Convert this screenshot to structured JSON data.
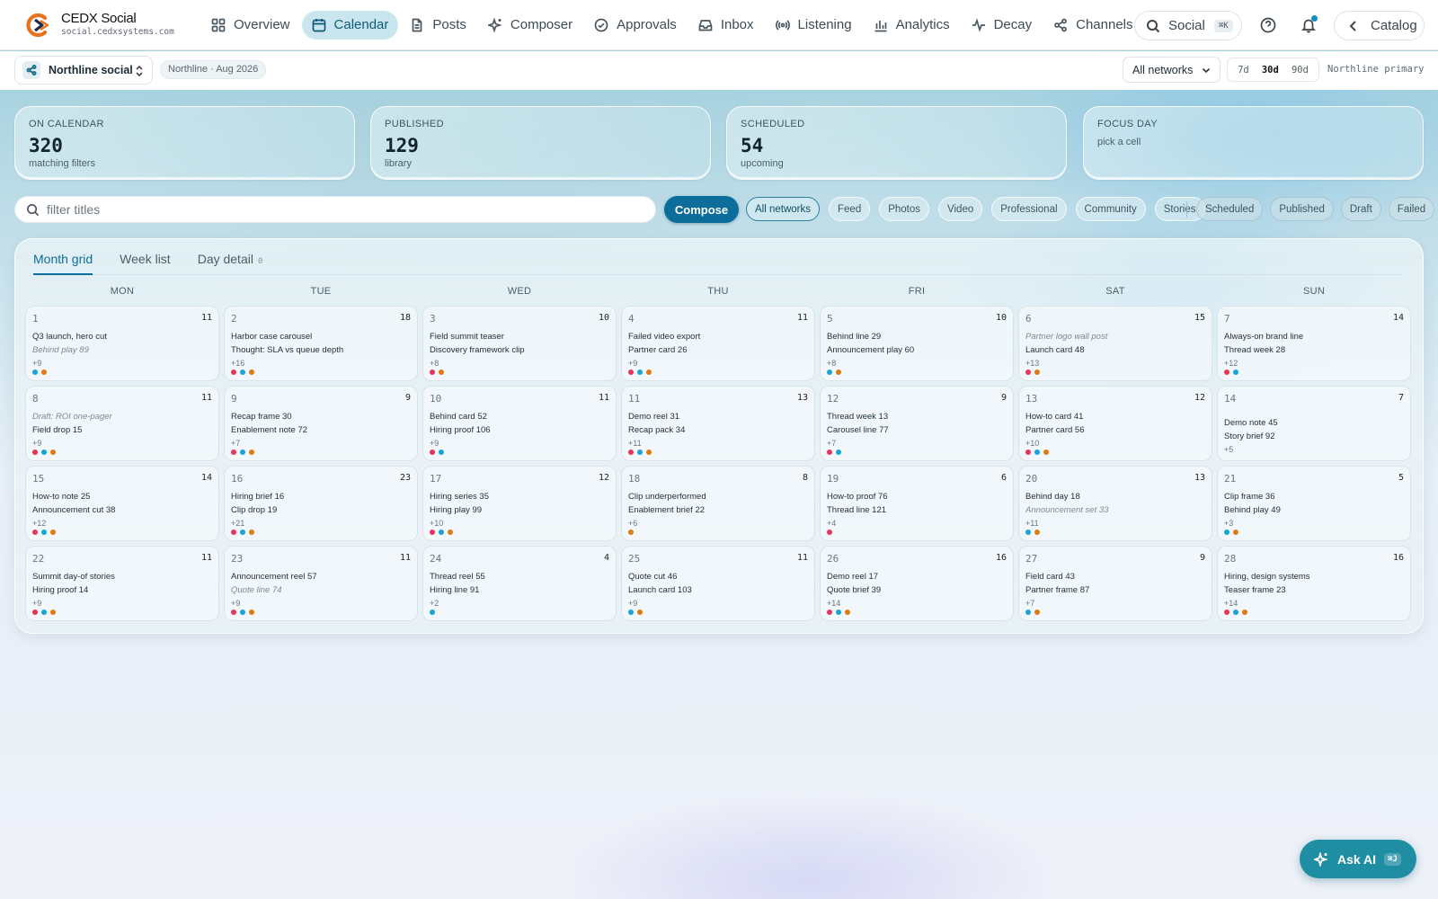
{
  "brand": {
    "title": "CEDX Social",
    "domain": "social.cedxsystems.com"
  },
  "nav": [
    {
      "label": "Overview",
      "icon": "grid-icon",
      "active": false
    },
    {
      "label": "Calendar",
      "icon": "calendar-icon",
      "active": true
    },
    {
      "label": "Posts",
      "icon": "document-icon",
      "active": false
    },
    {
      "label": "Composer",
      "icon": "sparkle-icon",
      "active": false
    },
    {
      "label": "Approvals",
      "icon": "check-circle-icon",
      "active": false
    },
    {
      "label": "Inbox",
      "icon": "inbox-icon",
      "active": false
    },
    {
      "label": "Listening",
      "icon": "broadcast-icon",
      "active": false
    },
    {
      "label": "Analytics",
      "icon": "bar-chart-icon",
      "active": false
    },
    {
      "label": "Decay",
      "icon": "pulse-icon",
      "active": false
    },
    {
      "label": "Channels",
      "icon": "share-icon",
      "active": false
    }
  ],
  "search": {
    "label": "Social",
    "shortcut": "⌘K"
  },
  "catalog": {
    "label": "Catalog"
  },
  "workspace": {
    "name": "Northline social",
    "period": "Northline · Aug 2026"
  },
  "network_filter": {
    "selected": "All networks"
  },
  "ranges": [
    {
      "label": "7d",
      "active": false
    },
    {
      "label": "30d",
      "active": true
    },
    {
      "label": "90d",
      "active": false
    }
  ],
  "brand_kit": "Northline primary",
  "stats": [
    {
      "label": "On calendar",
      "value": "320",
      "sub": "matching filters"
    },
    {
      "label": "Published",
      "value": "129",
      "sub": "library"
    },
    {
      "label": "Scheduled",
      "value": "54",
      "sub": "upcoming"
    },
    {
      "label": "Focus day",
      "value": "",
      "sub": "pick a cell"
    }
  ],
  "filter": {
    "placeholder": "filter titles",
    "value": ""
  },
  "compose_label": "Compose",
  "network_chips": [
    {
      "label": "All networks",
      "active": true
    },
    {
      "label": "Feed",
      "active": false
    },
    {
      "label": "Photos",
      "active": false
    },
    {
      "label": "Video",
      "active": false
    },
    {
      "label": "Professional",
      "active": false
    },
    {
      "label": "Community",
      "active": false
    },
    {
      "label": "Stories",
      "active": false
    }
  ],
  "status_chips": [
    {
      "label": "Scheduled"
    },
    {
      "label": "Published"
    },
    {
      "label": "Draft"
    },
    {
      "label": "Failed"
    }
  ],
  "view_tabs": [
    {
      "label": "Month grid",
      "active": true,
      "count": ""
    },
    {
      "label": "Week list",
      "active": false,
      "count": ""
    },
    {
      "label": "Day detail",
      "active": false,
      "count": "0"
    }
  ],
  "weekdays": [
    "MON",
    "TUE",
    "WED",
    "THU",
    "FRI",
    "SAT",
    "SUN"
  ],
  "dot_colors": {
    "pink": "#e8335a",
    "blue": "#1aa3d9",
    "orange": "#e07b12"
  },
  "days": [
    {
      "day": "1",
      "count": "11",
      "posts": [
        {
          "t": "Q3 launch, hero cut"
        },
        {
          "t": "Behind play 89",
          "draft": true
        }
      ],
      "more": "+9",
      "dots": [
        "blue",
        "orange"
      ]
    },
    {
      "day": "2",
      "count": "18",
      "posts": [
        {
          "t": "Harbor case carousel"
        },
        {
          "t": "Thought: SLA vs queue depth"
        }
      ],
      "more": "+16",
      "dots": [
        "pink",
        "blue",
        "orange"
      ]
    },
    {
      "day": "3",
      "count": "10",
      "posts": [
        {
          "t": "Field summit teaser"
        },
        {
          "t": "Discovery framework clip"
        }
      ],
      "more": "+8",
      "dots": [
        "pink",
        "orange"
      ]
    },
    {
      "day": "4",
      "count": "11",
      "posts": [
        {
          "t": "Failed video export"
        },
        {
          "t": "Partner card 26"
        }
      ],
      "more": "+9",
      "dots": [
        "pink",
        "blue",
        "orange"
      ]
    },
    {
      "day": "5",
      "count": "10",
      "posts": [
        {
          "t": "Behind line 29"
        },
        {
          "t": "Announcement play 60"
        }
      ],
      "more": "+8",
      "dots": [
        "blue",
        "orange"
      ]
    },
    {
      "day": "6",
      "count": "15",
      "posts": [
        {
          "t": "Partner logo wall post",
          "draft": true
        },
        {
          "t": "Launch card 48"
        }
      ],
      "more": "+13",
      "dots": [
        "pink",
        "orange"
      ]
    },
    {
      "day": "7",
      "count": "14",
      "posts": [
        {
          "t": "Always-on brand line"
        },
        {
          "t": "Thread week 28"
        }
      ],
      "more": "+12",
      "dots": [
        "pink",
        "blue"
      ]
    },
    {
      "day": "8",
      "count": "11",
      "posts": [
        {
          "t": "Draft: ROI one-pager",
          "draft": true
        },
        {
          "t": "Field drop 15"
        }
      ],
      "more": "+9",
      "dots": [
        "pink",
        "blue",
        "orange"
      ]
    },
    {
      "day": "9",
      "count": "9",
      "posts": [
        {
          "t": "Recap frame 30"
        },
        {
          "t": "Enablement note 72"
        }
      ],
      "more": "+7",
      "dots": [
        "pink",
        "blue",
        "orange"
      ]
    },
    {
      "day": "10",
      "count": "11",
      "posts": [
        {
          "t": "Behind card 52"
        },
        {
          "t": "Hiring proof 106"
        }
      ],
      "more": "+9",
      "dots": [
        "pink",
        "blue"
      ]
    },
    {
      "day": "11",
      "count": "13",
      "posts": [
        {
          "t": "Demo reel 31"
        },
        {
          "t": "Recap pack 34"
        }
      ],
      "more": "+11",
      "dots": [
        "pink",
        "blue",
        "orange"
      ]
    },
    {
      "day": "12",
      "count": "9",
      "posts": [
        {
          "t": "Thread week 13"
        },
        {
          "t": "Carousel line 77"
        }
      ],
      "more": "+7",
      "dots": [
        "pink",
        "blue"
      ]
    },
    {
      "day": "13",
      "count": "12",
      "posts": [
        {
          "t": "How-to card 41"
        },
        {
          "t": "Partner card 56"
        }
      ],
      "more": "+10",
      "dots": [
        "pink",
        "blue",
        "orange"
      ]
    },
    {
      "day": "14",
      "count": "7",
      "posts": [
        {
          "t": "Demo note 45"
        },
        {
          "t": "Story brief 92"
        }
      ],
      "more": "+5",
      "dots": []
    },
    {
      "day": "15",
      "count": "14",
      "posts": [
        {
          "t": "How-to note 25"
        },
        {
          "t": "Announcement cut 38"
        }
      ],
      "more": "+12",
      "dots": [
        "pink",
        "blue",
        "orange"
      ]
    },
    {
      "day": "16",
      "count": "23",
      "posts": [
        {
          "t": "Hiring brief 16"
        },
        {
          "t": "Clip drop 19"
        }
      ],
      "more": "+21",
      "dots": [
        "pink",
        "blue",
        "orange"
      ]
    },
    {
      "day": "17",
      "count": "12",
      "posts": [
        {
          "t": "Hiring series 35"
        },
        {
          "t": "Hiring play 99"
        }
      ],
      "more": "+10",
      "dots": [
        "pink",
        "blue",
        "orange"
      ]
    },
    {
      "day": "18",
      "count": "8",
      "posts": [
        {
          "t": "Clip underperformed"
        },
        {
          "t": "Enablement brief 22"
        }
      ],
      "more": "+6",
      "dots": [
        "orange"
      ]
    },
    {
      "day": "19",
      "count": "6",
      "posts": [
        {
          "t": "How-to proof 76"
        },
        {
          "t": "Thread line 121"
        }
      ],
      "more": "+4",
      "dots": [
        "pink"
      ]
    },
    {
      "day": "20",
      "count": "13",
      "posts": [
        {
          "t": "Behind day 18"
        },
        {
          "t": "Announcement set 33",
          "draft": true
        }
      ],
      "more": "+11",
      "dots": [
        "blue",
        "orange"
      ]
    },
    {
      "day": "21",
      "count": "5",
      "posts": [
        {
          "t": "Clip frame 36"
        },
        {
          "t": "Behind play 49"
        }
      ],
      "more": "+3",
      "dots": [
        "blue",
        "orange"
      ]
    },
    {
      "day": "22",
      "count": "11",
      "posts": [
        {
          "t": "Summit day-of stories"
        },
        {
          "t": "Hiring proof 14"
        }
      ],
      "more": "+9",
      "dots": [
        "pink",
        "blue",
        "orange"
      ]
    },
    {
      "day": "23",
      "count": "11",
      "posts": [
        {
          "t": "Announcement reel 57"
        },
        {
          "t": "Quote line 74",
          "draft": true
        }
      ],
      "more": "+9",
      "dots": [
        "pink",
        "blue",
        "orange"
      ]
    },
    {
      "day": "24",
      "count": "4",
      "posts": [
        {
          "t": "Thread reel 55"
        },
        {
          "t": "Hiring line 91"
        }
      ],
      "more": "+2",
      "dots": [
        "blue"
      ]
    },
    {
      "day": "25",
      "count": "11",
      "posts": [
        {
          "t": "Quote cut 46"
        },
        {
          "t": "Launch card 103"
        }
      ],
      "more": "+9",
      "dots": [
        "blue",
        "orange"
      ]
    },
    {
      "day": "26",
      "count": "16",
      "posts": [
        {
          "t": "Demo reel 17"
        },
        {
          "t": "Quote brief 39"
        }
      ],
      "more": "+14",
      "dots": [
        "pink",
        "blue",
        "orange"
      ]
    },
    {
      "day": "27",
      "count": "9",
      "posts": [
        {
          "t": "Field card 43"
        },
        {
          "t": "Partner frame 87"
        }
      ],
      "more": "+7",
      "dots": [
        "blue",
        "orange"
      ]
    },
    {
      "day": "28",
      "count": "16",
      "posts": [
        {
          "t": "Hiring, design systems"
        },
        {
          "t": "Teaser frame 23"
        }
      ],
      "more": "+14",
      "dots": [
        "pink",
        "blue",
        "orange"
      ]
    }
  ],
  "ask_ai": {
    "label": "Ask AI",
    "shortcut": "⌘J"
  }
}
